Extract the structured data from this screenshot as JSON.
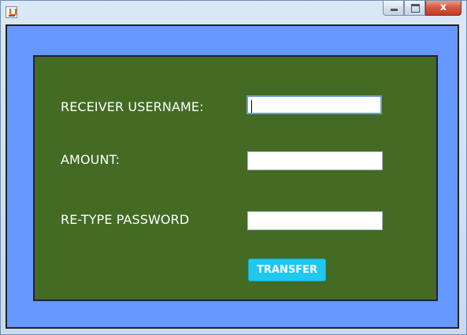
{
  "window": {
    "controls": {
      "minimize": "–",
      "maximize": "□",
      "close": "x"
    }
  },
  "form": {
    "receiver_label": "RECEIVER USERNAME:",
    "receiver_value": "",
    "amount_label": "AMOUNT:",
    "amount_value": "",
    "password_label": "RE-TYPE PASSWORD",
    "password_value": "",
    "transfer_button": "TRANSFER"
  },
  "colors": {
    "frame": "#6699ff",
    "panel": "#436b24",
    "button": "#1ec8f0",
    "label_text": "#ffffff"
  },
  "icons": {
    "app": "java-icon",
    "minimize": "minimize-icon",
    "maximize": "maximize-icon",
    "close": "close-icon"
  }
}
